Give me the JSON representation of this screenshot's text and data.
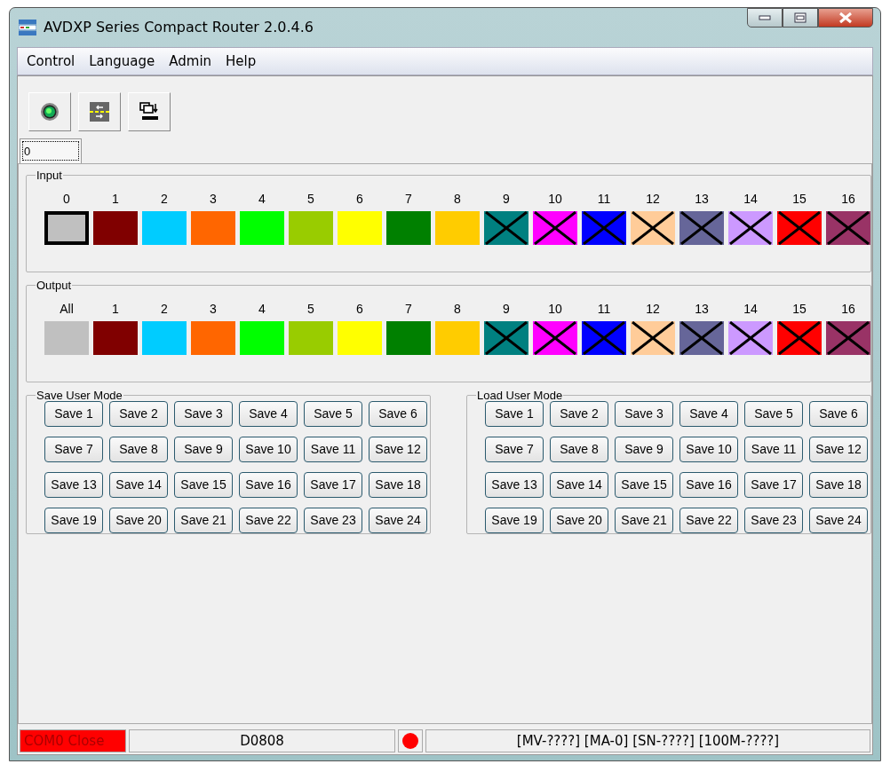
{
  "window": {
    "title": "AVDXP Series Compact Router 2.0.4.6"
  },
  "menu": [
    "Control",
    "Language",
    "Admin",
    "Help"
  ],
  "toolbar": [
    {
      "kind": "connect"
    },
    {
      "kind": "switch"
    },
    {
      "kind": "transfer"
    }
  ],
  "tabs": [
    {
      "label": "0",
      "selected": true
    }
  ],
  "input": {
    "title": "Input",
    "channels": [
      {
        "label": "0",
        "color": "#c0c0c0",
        "crossed": false,
        "selected": true
      },
      {
        "label": "1",
        "color": "#800000",
        "crossed": false,
        "selected": false
      },
      {
        "label": "2",
        "color": "#00ccff",
        "crossed": false,
        "selected": false
      },
      {
        "label": "3",
        "color": "#ff6600",
        "crossed": false,
        "selected": false
      },
      {
        "label": "4",
        "color": "#00ff00",
        "crossed": false,
        "selected": false
      },
      {
        "label": "5",
        "color": "#99cc00",
        "crossed": false,
        "selected": false
      },
      {
        "label": "6",
        "color": "#ffff00",
        "crossed": false,
        "selected": false
      },
      {
        "label": "7",
        "color": "#008000",
        "crossed": false,
        "selected": false
      },
      {
        "label": "8",
        "color": "#ffcc00",
        "crossed": false,
        "selected": false
      },
      {
        "label": "9",
        "color": "#008080",
        "crossed": true,
        "selected": false
      },
      {
        "label": "10",
        "color": "#ff00ff",
        "crossed": true,
        "selected": false
      },
      {
        "label": "11",
        "color": "#0000ff",
        "crossed": true,
        "selected": false
      },
      {
        "label": "12",
        "color": "#ffcc99",
        "crossed": true,
        "selected": false
      },
      {
        "label": "13",
        "color": "#666699",
        "crossed": true,
        "selected": false
      },
      {
        "label": "14",
        "color": "#cc99ff",
        "crossed": true,
        "selected": false
      },
      {
        "label": "15",
        "color": "#ff0000",
        "crossed": true,
        "selected": false
      },
      {
        "label": "16",
        "color": "#993366",
        "crossed": true,
        "selected": false
      }
    ]
  },
  "output": {
    "title": "Output",
    "channels": [
      {
        "label": "All",
        "color": "#c0c0c0",
        "crossed": false,
        "selected": false
      },
      {
        "label": "1",
        "color": "#800000",
        "crossed": false,
        "selected": false
      },
      {
        "label": "2",
        "color": "#00ccff",
        "crossed": false,
        "selected": false
      },
      {
        "label": "3",
        "color": "#ff6600",
        "crossed": false,
        "selected": false
      },
      {
        "label": "4",
        "color": "#00ff00",
        "crossed": false,
        "selected": false
      },
      {
        "label": "5",
        "color": "#99cc00",
        "crossed": false,
        "selected": false
      },
      {
        "label": "6",
        "color": "#ffff00",
        "crossed": false,
        "selected": false
      },
      {
        "label": "7",
        "color": "#008000",
        "crossed": false,
        "selected": false
      },
      {
        "label": "8",
        "color": "#ffcc00",
        "crossed": false,
        "selected": false
      },
      {
        "label": "9",
        "color": "#008080",
        "crossed": true,
        "selected": false
      },
      {
        "label": "10",
        "color": "#ff00ff",
        "crossed": true,
        "selected": false
      },
      {
        "label": "11",
        "color": "#0000ff",
        "crossed": true,
        "selected": false
      },
      {
        "label": "12",
        "color": "#ffcc99",
        "crossed": true,
        "selected": false
      },
      {
        "label": "13",
        "color": "#666699",
        "crossed": true,
        "selected": false
      },
      {
        "label": "14",
        "color": "#cc99ff",
        "crossed": true,
        "selected": false
      },
      {
        "label": "15",
        "color": "#ff0000",
        "crossed": true,
        "selected": false
      },
      {
        "label": "16",
        "color": "#993366",
        "crossed": true,
        "selected": false
      }
    ]
  },
  "save_user_mode": {
    "title": "Save User Mode",
    "buttons": [
      "Save 1",
      "Save 2",
      "Save 3",
      "Save 4",
      "Save 5",
      "Save 6",
      "Save 7",
      "Save 8",
      "Save 9",
      "Save 10",
      "Save 11",
      "Save 12",
      "Save 13",
      "Save 14",
      "Save 15",
      "Save 16",
      "Save 17",
      "Save 18",
      "Save 19",
      "Save 20",
      "Save 21",
      "Save 22",
      "Save 23",
      "Save 24"
    ]
  },
  "load_user_mode": {
    "title": "Load User Mode",
    "buttons": [
      "Save 1",
      "Save 2",
      "Save 3",
      "Save 4",
      "Save 5",
      "Save 6",
      "Save 7",
      "Save 8",
      "Save 9",
      "Save 10",
      "Save 11",
      "Save 12",
      "Save 13",
      "Save 14",
      "Save 15",
      "Save 16",
      "Save 17",
      "Save 18",
      "Save 19",
      "Save 20",
      "Save 21",
      "Save 22",
      "Save 23",
      "Save 24"
    ]
  },
  "status_bar": {
    "port": "COM0 Close",
    "connected": false,
    "model": "D0808",
    "info": "[MV-????] [MA-0] [SN-????] [100M-????]"
  }
}
